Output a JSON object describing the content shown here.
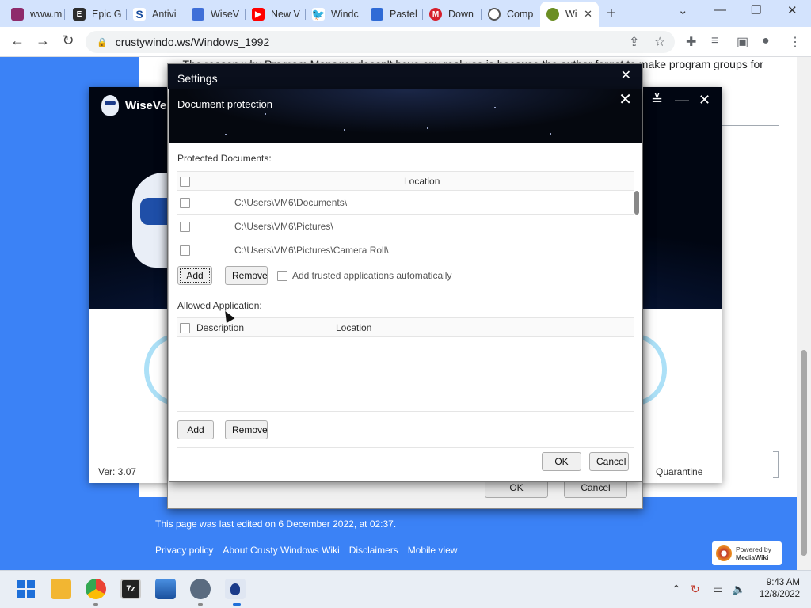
{
  "browser": {
    "tabs": [
      {
        "label": "www.m",
        "icon": "wiki-favicon",
        "color": "#8e2b6b"
      },
      {
        "label": "Epic G",
        "icon": "epic-games-icon",
        "color": "#2d2d2d"
      },
      {
        "label": "Antivi",
        "icon": "s-logo-icon",
        "color": "#1a4fa0"
      },
      {
        "label": "WiseV",
        "icon": "wisevector-icon",
        "color": "#3f6fd8"
      },
      {
        "label": "New V",
        "icon": "youtube-icon",
        "color": "#ff0000"
      },
      {
        "label": "Windc",
        "icon": "twitter-icon",
        "color": "#1da1f2"
      },
      {
        "label": "Pastel",
        "icon": "pastel-icon",
        "color": "#2f6bd6"
      },
      {
        "label": "Down",
        "icon": "malwarebytes-icon",
        "color": "#d61f2c"
      },
      {
        "label": "Comp",
        "icon": "compare-icon",
        "color": "#555555"
      },
      {
        "label": "Wi",
        "icon": "crusty-wiki-icon",
        "color": "#6b8e23"
      }
    ],
    "url": "crustywindo.ws/Windows_1992"
  },
  "wiki": {
    "text_line": "The reason why Program Manager doesn't have any real use is because the author forgot to make program groups for",
    "last_edited": "This page was last edited on 6 December 2022, at 02:37.",
    "footer_links": [
      "Privacy policy",
      "About Crusty Windows Wiki",
      "Disclaimers",
      "Mobile view"
    ],
    "powered_by": [
      "Powered by",
      "MediaWiki"
    ]
  },
  "wisevector": {
    "brand": "WiseVec",
    "version": "Ver: 3.07",
    "quarantine": "Quarantine",
    "colors": {
      "banner_dark": "#010612",
      "banner_glow": "#3f7df5",
      "ring": "#8ad4f5"
    }
  },
  "settings": {
    "title": "Settings",
    "ok": "OK",
    "cancel": "Cancel"
  },
  "doc_protection": {
    "title": "Document protection",
    "protected_label": "Protected Documents:",
    "location_header": "Location",
    "protected_rows": [
      "C:\\Users\\VM6\\Documents\\",
      "C:\\Users\\VM6\\Pictures\\",
      "C:\\Users\\VM6\\Pictures\\Camera Roll\\"
    ],
    "add": "Add",
    "remove": "Remove",
    "auto_trust": "Add trusted applications automatically",
    "allowed_label": "Allowed Application:",
    "description_header": "Description",
    "location_header2": "Location",
    "add2": "Add",
    "remove2": "Remove",
    "ok": "OK",
    "cancel": "Cancel"
  },
  "taskbar": {
    "apps": [
      {
        "name": "start-icon",
        "color": "#1e6fd9"
      },
      {
        "name": "file-explorer-icon",
        "color": "#f2b632"
      },
      {
        "name": "chrome-icon",
        "color": "#34a853"
      },
      {
        "name": "7zip-icon",
        "color": "#222222",
        "label": "7z"
      },
      {
        "name": "photos-icon",
        "color": "#2a6fc9"
      },
      {
        "name": "settings-icon",
        "color": "#5a6b80"
      },
      {
        "name": "wisevector-icon",
        "color": "#1b3b8a"
      }
    ],
    "time": "9:43 AM",
    "date": "12/8/2022"
  }
}
